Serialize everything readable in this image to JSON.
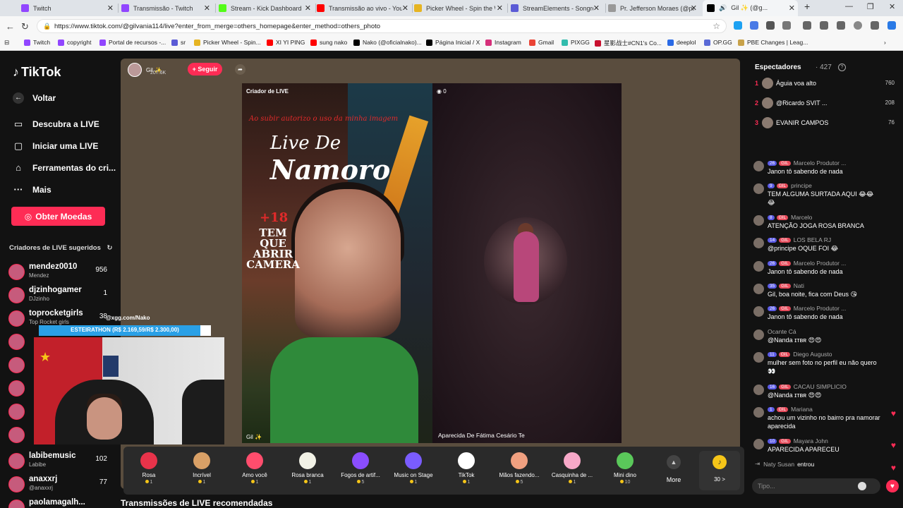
{
  "browser": {
    "tabs": [
      {
        "title": "Twitch",
        "color": "#9146ff"
      },
      {
        "title": "Transmissão - Twitch",
        "color": "#9146ff"
      },
      {
        "title": "Stream - Kick Dashboard",
        "color": "#53fc18"
      },
      {
        "title": "Transmissão ao vivo - YouTube",
        "color": "#ff0000"
      },
      {
        "title": "Picker Wheel - Spin the Wheel",
        "color": "#e6b422"
      },
      {
        "title": "StreamElements - Songrequest",
        "color": "#5b5bd6"
      },
      {
        "title": "Pr. Jefferson Moraes (@pr.je...",
        "color": "#999999"
      },
      {
        "title": "Gil ✨ (@g...",
        "color": "#000000"
      }
    ],
    "url": "https://www.tiktok.com/@gilvania114/live?enter_from_merge=others_homepage&enter_method=others_photo",
    "bookmarks": [
      "Twitch",
      "copyright",
      "Portal de recursos -...",
      "sr",
      "Picker Wheel - Spin...",
      "XI YI PING",
      "sung nako",
      "Nako (@oficialnako)...",
      "Página Inicial / X",
      "Instagram",
      "Gmail",
      "PIXGG",
      "星影战士#CN1's Co...",
      "deeplol",
      "OP.GG",
      "PBE Changes | Leag..."
    ]
  },
  "nav": {
    "logo": "TikTok",
    "back": "Voltar",
    "discover": "Descubra a LIVE",
    "start_live": "Iniciar uma LIVE",
    "creator_tools": "Ferramentas do cri...",
    "more": "Mais",
    "get_coins": "Obter Moedas",
    "suggested_title": "Criadores de LIVE sugeridos",
    "creators": [
      {
        "name": "mendez0010",
        "sub": "Mendez",
        "count": "956"
      },
      {
        "name": "djzinhogamer",
        "sub": "DJzinho",
        "count": "1"
      },
      {
        "name": "toprocketgirls",
        "sub": "Top Rocket girls",
        "count": "38"
      },
      {
        "name": "labibemusic",
        "sub": "Labibe",
        "count": "102"
      },
      {
        "name": "anaxxrj",
        "sub": "@anaxxrj",
        "count": "77"
      },
      {
        "name": "paolamagalh...",
        "sub": "",
        "count": ""
      }
    ]
  },
  "live": {
    "host_name": "Gil ✨",
    "host_likes": "207.6K",
    "follow": "+ Seguir",
    "left_label": "Criador de LIVE",
    "overlay_warning": "Ao subir autorizo o uso da minha imagem",
    "overlay_title_1": "Live De",
    "overlay_title_2": "Namoro",
    "overlay_plus18": "+18",
    "overlay_tem": "TEM QUE ABRIR CAMERA",
    "left_bottom_name": "Gil ✨",
    "right_viewers": "0",
    "right_name": "Aparecida De Fátima Cesário Te",
    "recommended": "Transmissões de LIVE recomendadas"
  },
  "gifts": [
    {
      "name": "Rosa",
      "cost": "1",
      "color": "#e8334a"
    },
    {
      "name": "Incrível",
      "cost": "1",
      "color": "#d9a066"
    },
    {
      "name": "Amo você",
      "cost": "1",
      "color": "#ff4d6d"
    },
    {
      "name": "Rosa branca",
      "cost": "1",
      "color": "#f2f2e6"
    },
    {
      "name": "Fogos de artif...",
      "cost": "5",
      "color": "#8a4dff"
    },
    {
      "name": "Music on Stage",
      "cost": "1",
      "color": "#7a5cff"
    },
    {
      "name": "TikTok",
      "cost": "1",
      "color": "#ffffff"
    },
    {
      "name": "Mãos fazendo...",
      "cost": "5",
      "color": "#f0a080"
    },
    {
      "name": "Casquinha de ...",
      "cost": "1",
      "color": "#f7a8c8"
    },
    {
      "name": "Mini dino",
      "cost": "10",
      "color": "#5ac85a"
    }
  ],
  "gift_more": "More",
  "coins_label": "30 >",
  "webcam": {
    "handle": "@xgg.com/Nako",
    "goal_text": "ESTEIRATHON (R$ 2.169,59/R$ 2.300,00)",
    "goal_progress": 0.94
  },
  "chat": {
    "viewers_title": "Espectadores",
    "viewers_count": "· 427",
    "top_viewers": [
      {
        "rank": "1",
        "name": "Águia voa alto",
        "score": "760"
      },
      {
        "rank": "2",
        "name": "@Ricardo SVIT ...",
        "score": "208"
      },
      {
        "rank": "3",
        "name": "EVANIR CAMPOS",
        "score": "76"
      }
    ],
    "messages": [
      {
        "level": "26",
        "fan": "GIL",
        "user": "Marcelo Produtor ...",
        "text": "Janon tô sabendo de nada"
      },
      {
        "level": "9",
        "fan": "GIL",
        "user": "principe",
        "text": "TEM ALGUMA SURTADA AQUI 😂😂😂"
      },
      {
        "level": "8",
        "fan": "GIL",
        "user": "Marcelo",
        "text": "ATENÇÃO JOGA ROSA BRANCA"
      },
      {
        "level": "14",
        "fan": "GIL",
        "user": "LOS BELA RJ",
        "text": "@principe OQUE FOI 😂"
      },
      {
        "level": "26",
        "fan": "GIL",
        "user": "Marcelo Produtor ...",
        "text": "Janon tô sabendo de nada"
      },
      {
        "level": "35",
        "fan": "GIL",
        "user": "Nati",
        "text": "Gil, boa noite, fica com Deus 😘"
      },
      {
        "level": "26",
        "fan": "GIL",
        "user": "Marcelo Produtor ...",
        "text": "Janon tô sabendo de nada"
      },
      {
        "level": "",
        "fan": "",
        "user": "Ocante Cá",
        "text": "@Nanda ɪᴛʙʀ 😍😍"
      },
      {
        "level": "11",
        "fan": "GIL",
        "user": "Diego Augusto",
        "text": "mulher sem foto no perfil eu não quero 👀"
      },
      {
        "level": "16",
        "fan": "GIL",
        "user": "CACAU SIMPLICIO",
        "text": "@Nanda ɪᴛʙʀ 😍😍"
      },
      {
        "level": "1",
        "fan": "GIL",
        "user": "Mariana",
        "text": "achou um vizinho no bairro pra namorar aparecida"
      },
      {
        "level": "10",
        "fan": "GIL",
        "user": "Mayara John",
        "text": "APARECIDA APARECEU"
      }
    ],
    "join_user": "Naty Susan",
    "join_text": "entrou",
    "input_placeholder": "Tipo..."
  }
}
